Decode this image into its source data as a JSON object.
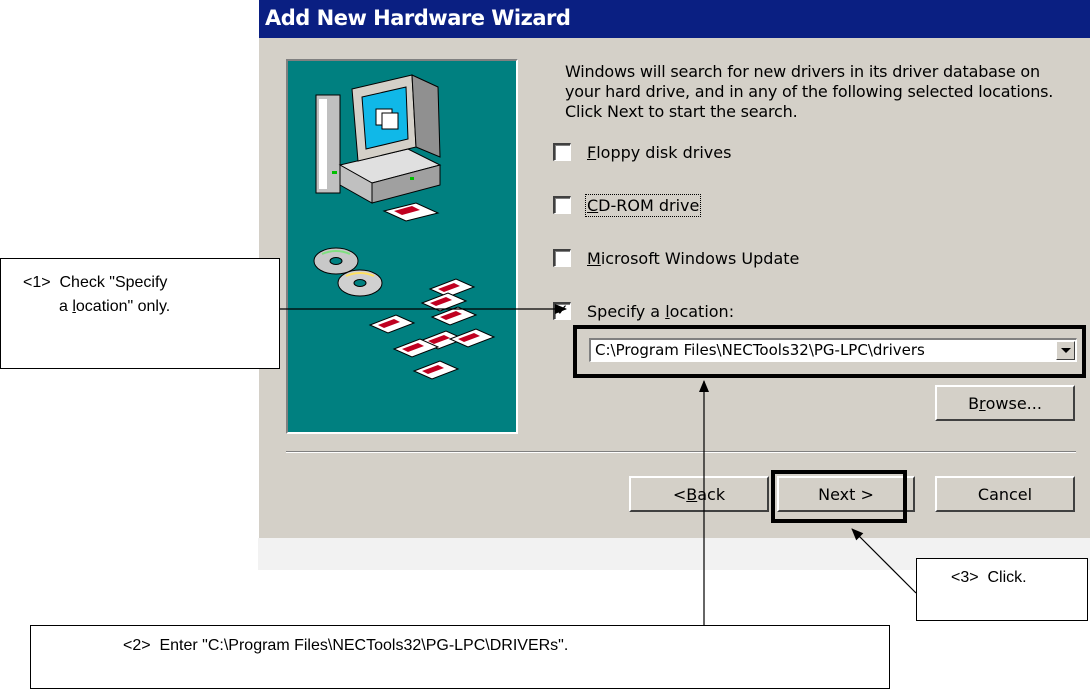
{
  "window": {
    "title": "Add New Hardware Wizard"
  },
  "wizard": {
    "intro": "Windows will search for new drivers in its driver database on your hard drive, and in any of the following selected locations. Click Next to start the search.",
    "options": [
      {
        "pre": "",
        "key": "F",
        "post": "loppy disk drives",
        "checked": false
      },
      {
        "pre": "",
        "key": "C",
        "post": "D-ROM drive",
        "checked": false
      },
      {
        "pre": "",
        "key": "M",
        "post": "icrosoft Windows Update",
        "checked": false
      },
      {
        "pre": "Specify a ",
        "key": "l",
        "post": "ocation:",
        "checked": true
      }
    ],
    "location_value": "C:\\Program Files\\NECTools32\\PG-LPC\\drivers",
    "browse": {
      "pre": "B",
      "key": "r",
      "post": "owse..."
    },
    "back": {
      "pre": "< ",
      "key": "B",
      "post": "ack"
    },
    "next_label": "Next >",
    "cancel_label": "Cancel"
  },
  "annotations": {
    "callout1": {
      "tag": "<1>",
      "line1": "Check \"Specify",
      "line2_pre": "a ",
      "line2_key": "l",
      "line2_post": "ocation\" only."
    },
    "callout2": {
      "tag": "<2>",
      "text": "Enter \"C:\\Program Files\\NECTools32\\PG-LPC\\DRIVERs\"."
    },
    "callout3": {
      "tag": "<3>",
      "text": "Click."
    }
  },
  "icons": [
    "computer-icon",
    "cd-discs-icon",
    "floppy-disks-icon",
    "dropdown-arrow-icon"
  ],
  "colors": {
    "title_bar": "#0a1f82",
    "dialog": "#d4d0c8",
    "illustration_bg": "#008080"
  }
}
